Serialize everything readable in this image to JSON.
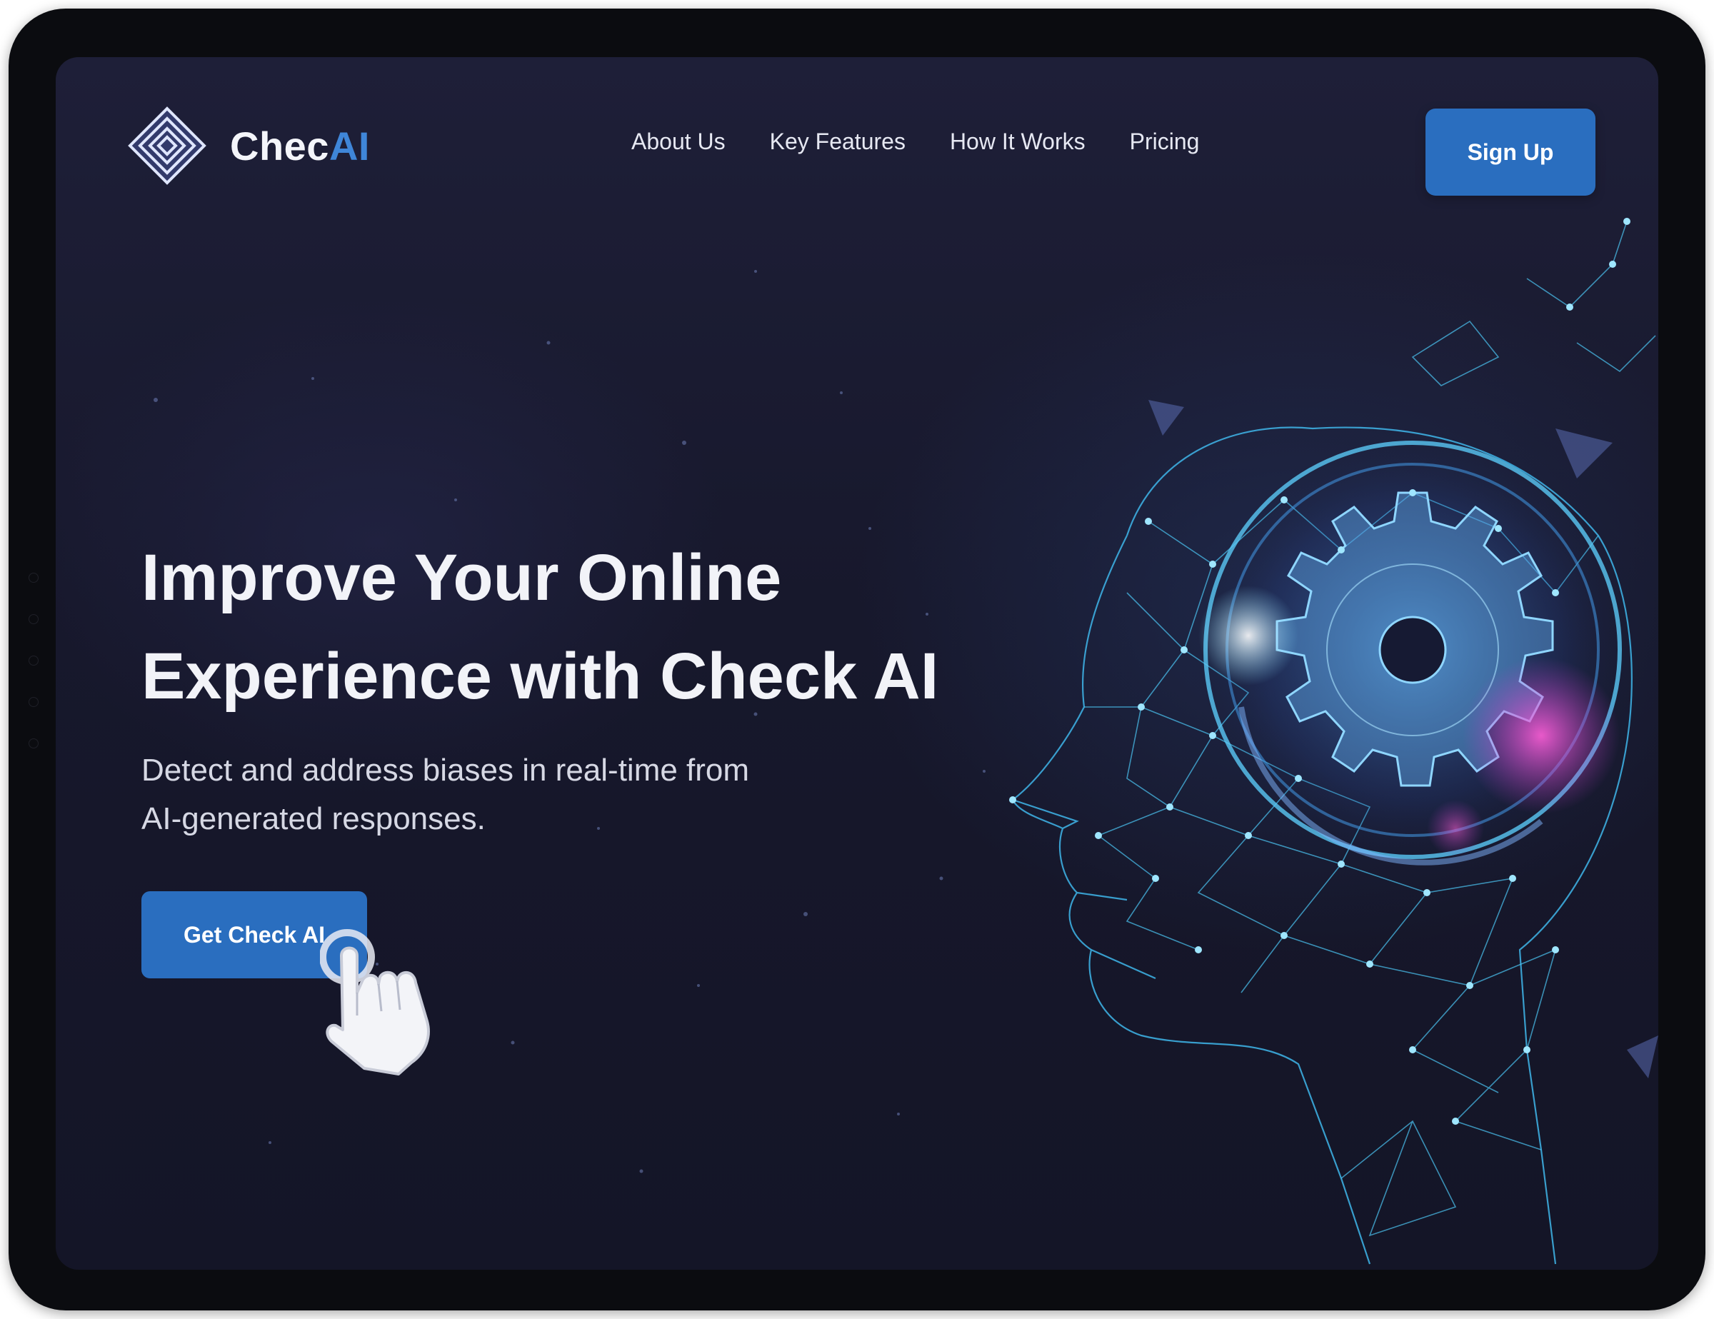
{
  "brand": {
    "name_prefix": "Chec",
    "name_suffix": "AI",
    "logo_icon": "diamond-concentric-icon",
    "accent_color": "#2a6ebf"
  },
  "nav": {
    "items": [
      {
        "label": "About Us"
      },
      {
        "label": "Key Features"
      },
      {
        "label": "How It Works"
      },
      {
        "label": "Pricing"
      }
    ]
  },
  "header": {
    "signup_label": "Sign Up"
  },
  "hero": {
    "title_line1": "Improve Your Online",
    "title_line2": "Experience with Check AI",
    "subtitle_line1": "Detect and address biases in real-time from",
    "subtitle_line2": "AI-generated responses.",
    "cta_label": "Get Check AI",
    "cursor_icon": "pointer-hand-icon",
    "illustration": "ai-head-gear-icon"
  },
  "colors": {
    "background": "#17182c",
    "button": "#2a6ebf",
    "text": "#f2f3f8",
    "network_cyan": "#49c6f0",
    "glow_magenta": "#c84bd6"
  }
}
